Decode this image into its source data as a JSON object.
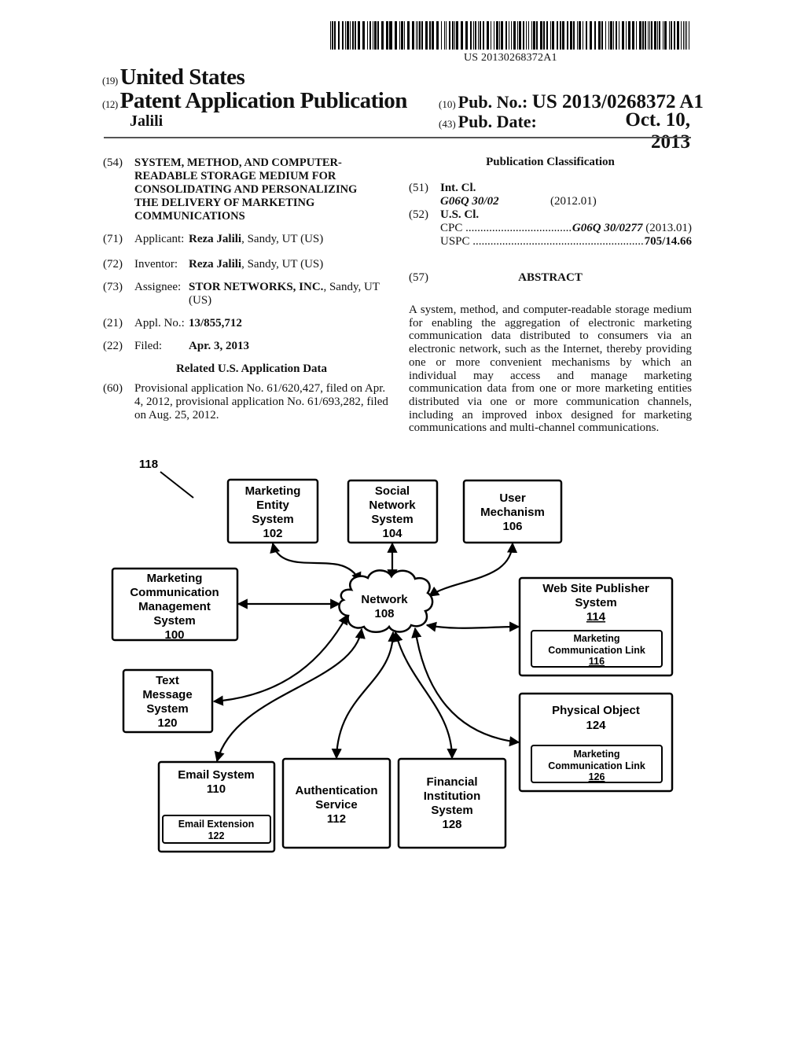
{
  "header": {
    "barcode_number": "US 20130268372A1",
    "country_code": "(19)",
    "country": "United States",
    "doc_type_code": "(12)",
    "doc_type": "Patent Application Publication",
    "first_inventor": "Jalili",
    "pub_no_code": "(10)",
    "pub_no_label": "Pub. No.:",
    "pub_no": "US 2013/0268372 A1",
    "pub_date_code": "(43)",
    "pub_date_label": "Pub. Date:",
    "pub_date": "Oct. 10, 2013"
  },
  "biblio": {
    "title_code": "(54)",
    "title": "SYSTEM, METHOD, AND COMPUTER-READABLE STORAGE MEDIUM FOR CONSOLIDATING AND PERSONALIZING THE DELIVERY OF MARKETING COMMUNICATIONS",
    "applicant": {
      "code": "(71)",
      "label": "Applicant:",
      "name": "Reza Jalili",
      "location": ", Sandy, UT (US)"
    },
    "inventor": {
      "code": "(72)",
      "label": "Inventor:",
      "name": "Reza Jalili",
      "location": ", Sandy, UT (US)"
    },
    "assignee": {
      "code": "(73)",
      "label": "Assignee:",
      "name": "STOR NETWORKS, INC.",
      "location": ", Sandy, UT",
      "location2": "(US)"
    },
    "appl_no": {
      "code": "(21)",
      "label": "Appl. No.:",
      "value": "13/855,712"
    },
    "filed": {
      "code": "(22)",
      "label": "Filed:",
      "value": "Apr. 3, 2013"
    },
    "related_heading": "Related U.S. Application Data",
    "provisional": {
      "code": "(60)",
      "text": "Provisional application No. 61/620,427, filed on Apr. 4, 2012, provisional application No. 61/693,282, filed on Aug. 25, 2012."
    }
  },
  "classification": {
    "heading": "Publication Classification",
    "int_cl": {
      "code": "(51)",
      "label": "Int. Cl.",
      "class": "G06Q 30/02",
      "version": "(2012.01)"
    },
    "us_cl": {
      "code": "(52)",
      "label": "U.S. Cl.",
      "cpc_label": "CPC",
      "cpc_class": "G06Q 30/0277",
      "cpc_version": "(2013.01)",
      "uspc_label": "USPC",
      "uspc_class": "705/14.66"
    }
  },
  "abstract": {
    "code": "(57)",
    "heading": "ABSTRACT",
    "text": "A system, method, and computer-readable storage medium for enabling the aggregation of electronic marketing communication data distributed to consumers via an electronic network, such as the Internet, thereby providing one or more convenient mechanisms by which an individual may access and manage marketing communication data from one or more marketing entities distributed via one or more communication channels, including an improved inbox designed for marketing communications and multi-channel communications."
  },
  "figure": {
    "ref_label": "118",
    "network": {
      "lines": [
        "Network",
        "108"
      ]
    },
    "nodes": {
      "n100": {
        "lines": [
          "Marketing",
          "Communication",
          "Management",
          "System",
          "100"
        ]
      },
      "n102": {
        "lines": [
          "Marketing",
          "Entity",
          "System",
          "102"
        ]
      },
      "n104": {
        "lines": [
          "Social",
          "Network",
          "System",
          "104"
        ]
      },
      "n106": {
        "lines": [
          "User",
          "Mechanism",
          "106"
        ]
      },
      "n114": {
        "lines": [
          "Web Site Publisher",
          "System",
          "114"
        ],
        "inner": [
          "Marketing",
          "Communication Link",
          "116"
        ]
      },
      "n120": {
        "lines": [
          "Text",
          "Message",
          "System",
          "120"
        ]
      },
      "n110": {
        "lines": [
          "Email System",
          "110"
        ],
        "inner": [
          "Email Extension",
          "122"
        ]
      },
      "n112": {
        "lines": [
          "Authentication",
          "Service",
          "112"
        ]
      },
      "n128": {
        "lines": [
          "Financial",
          "Institution",
          "System",
          "128"
        ]
      },
      "n124": {
        "lines": [
          "Physical Object",
          "124"
        ],
        "inner": [
          "Marketing",
          "Communication Link",
          "126"
        ]
      }
    }
  }
}
